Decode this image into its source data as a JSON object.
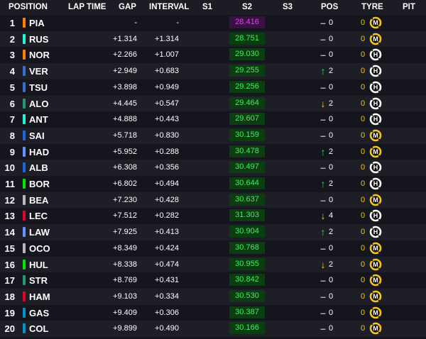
{
  "headers": {
    "position": "POSITION",
    "lap_time": "LAP TIME",
    "gap": "GAP",
    "interval": "INTERVAL",
    "s1": "S1",
    "s2": "S2",
    "s3": "S3",
    "pos": "POS",
    "tyre": "TYRE",
    "pit": "PIT"
  },
  "colors": {
    "background": "#15151e",
    "row_alt": "#1e1e27",
    "s2_green_bg": "#0c3c12",
    "s2_green_text": "#3ef35c",
    "s2_purple_bg": "#3a1044",
    "s2_purple_text": "#e142ff",
    "soft": "#e0e0e0",
    "medium": "#f5c518",
    "hard": "#ffffff",
    "lap_count": "#f5c518"
  },
  "rows": [
    {
      "pos": "1",
      "code": "PIA",
      "color": "#ff8000",
      "lap_time": "",
      "gap": "-",
      "interval": "-",
      "s2": "28.416",
      "s2_best": true,
      "arrow": "–",
      "trend": "none",
      "change": "0",
      "tyre": "M",
      "laps": "0"
    },
    {
      "pos": "2",
      "code": "RUS",
      "color": "#27f4d2",
      "lap_time": "",
      "gap": "+1.314",
      "interval": "+1.314",
      "s2": "28.751",
      "s2_best": false,
      "arrow": "–",
      "trend": "none",
      "change": "0",
      "tyre": "M",
      "laps": "0"
    },
    {
      "pos": "3",
      "code": "NOR",
      "color": "#ff8000",
      "lap_time": "",
      "gap": "+2.266",
      "interval": "+1.007",
      "s2": "29.030",
      "s2_best": false,
      "arrow": "–",
      "trend": "none",
      "change": "0",
      "tyre": "H",
      "laps": "0"
    },
    {
      "pos": "4",
      "code": "VER",
      "color": "#3671c6",
      "lap_time": "",
      "gap": "+2.949",
      "interval": "+0.683",
      "s2": "29.255",
      "s2_best": false,
      "arrow": "↑",
      "trend": "up",
      "change": "2",
      "tyre": "H",
      "laps": "0"
    },
    {
      "pos": "5",
      "code": "TSU",
      "color": "#3671c6",
      "lap_time": "",
      "gap": "+3.898",
      "interval": "+0.949",
      "s2": "29.256",
      "s2_best": false,
      "arrow": "–",
      "trend": "none",
      "change": "0",
      "tyre": "H",
      "laps": "0"
    },
    {
      "pos": "6",
      "code": "ALO",
      "color": "#229971",
      "lap_time": "",
      "gap": "+4.445",
      "interval": "+0.547",
      "s2": "29.464",
      "s2_best": false,
      "arrow": "↓",
      "trend": "down",
      "change": "2",
      "tyre": "H",
      "laps": "0"
    },
    {
      "pos": "7",
      "code": "ANT",
      "color": "#27f4d2",
      "lap_time": "",
      "gap": "+4.888",
      "interval": "+0.443",
      "s2": "29.607",
      "s2_best": false,
      "arrow": "–",
      "trend": "none",
      "change": "0",
      "tyre": "H",
      "laps": "0"
    },
    {
      "pos": "8",
      "code": "SAI",
      "color": "#1868db",
      "lap_time": "",
      "gap": "+5.718",
      "interval": "+0.830",
      "s2": "30.159",
      "s2_best": false,
      "arrow": "–",
      "trend": "none",
      "change": "0",
      "tyre": "M",
      "laps": "0"
    },
    {
      "pos": "9",
      "code": "HAD",
      "color": "#6692ff",
      "lap_time": "",
      "gap": "+5.952",
      "interval": "+0.288",
      "s2": "30.478",
      "s2_best": false,
      "arrow": "↑",
      "trend": "up",
      "change": "2",
      "tyre": "M",
      "laps": "0"
    },
    {
      "pos": "10",
      "code": "ALB",
      "color": "#1868db",
      "lap_time": "",
      "gap": "+6.308",
      "interval": "+0.356",
      "s2": "30.497",
      "s2_best": false,
      "arrow": "–",
      "trend": "none",
      "change": "0",
      "tyre": "H",
      "laps": "0"
    },
    {
      "pos": "11",
      "code": "BOR",
      "color": "#00e700",
      "lap_time": "",
      "gap": "+6.802",
      "interval": "+0.494",
      "s2": "30.644",
      "s2_best": false,
      "arrow": "↑",
      "trend": "up",
      "change": "2",
      "tyre": "H",
      "laps": "0"
    },
    {
      "pos": "12",
      "code": "BEA",
      "color": "#b6babd",
      "lap_time": "",
      "gap": "+7.230",
      "interval": "+0.428",
      "s2": "30.637",
      "s2_best": false,
      "arrow": "–",
      "trend": "none",
      "change": "0",
      "tyre": "M",
      "laps": "0"
    },
    {
      "pos": "13",
      "code": "LEC",
      "color": "#e8002d",
      "lap_time": "",
      "gap": "+7.512",
      "interval": "+0.282",
      "s2": "31.303",
      "s2_best": false,
      "arrow": "↓",
      "trend": "down",
      "change": "4",
      "tyre": "H",
      "laps": "0"
    },
    {
      "pos": "14",
      "code": "LAW",
      "color": "#6692ff",
      "lap_time": "",
      "gap": "+7.925",
      "interval": "+0.413",
      "s2": "30.904",
      "s2_best": false,
      "arrow": "↑",
      "trend": "up",
      "change": "2",
      "tyre": "H",
      "laps": "0"
    },
    {
      "pos": "15",
      "code": "OCO",
      "color": "#b6babd",
      "lap_time": "",
      "gap": "+8.349",
      "interval": "+0.424",
      "s2": "30.768",
      "s2_best": false,
      "arrow": "–",
      "trend": "none",
      "change": "0",
      "tyre": "M",
      "laps": "0"
    },
    {
      "pos": "16",
      "code": "HUL",
      "color": "#00e700",
      "lap_time": "",
      "gap": "+8.338",
      "interval": "+0.474",
      "s2": "30.955",
      "s2_best": false,
      "arrow": "↓",
      "trend": "down",
      "change": "2",
      "tyre": "M",
      "laps": "0"
    },
    {
      "pos": "17",
      "code": "STR",
      "color": "#229971",
      "lap_time": "",
      "gap": "+8.769",
      "interval": "+0.431",
      "s2": "30.842",
      "s2_best": false,
      "arrow": "–",
      "trend": "none",
      "change": "0",
      "tyre": "M",
      "laps": "0"
    },
    {
      "pos": "18",
      "code": "HAM",
      "color": "#e8002d",
      "lap_time": "",
      "gap": "+9.103",
      "interval": "+0.334",
      "s2": "30.530",
      "s2_best": false,
      "arrow": "–",
      "trend": "none",
      "change": "0",
      "tyre": "M",
      "laps": "0"
    },
    {
      "pos": "19",
      "code": "GAS",
      "color": "#0093cc",
      "lap_time": "",
      "gap": "+9.409",
      "interval": "+0.306",
      "s2": "30.387",
      "s2_best": false,
      "arrow": "–",
      "trend": "none",
      "change": "0",
      "tyre": "M",
      "laps": "0"
    },
    {
      "pos": "20",
      "code": "COL",
      "color": "#0093cc",
      "lap_time": "",
      "gap": "+9.899",
      "interval": "+0.490",
      "s2": "30.166",
      "s2_best": false,
      "arrow": "–",
      "trend": "none",
      "change": "0",
      "tyre": "M",
      "laps": "0"
    }
  ]
}
